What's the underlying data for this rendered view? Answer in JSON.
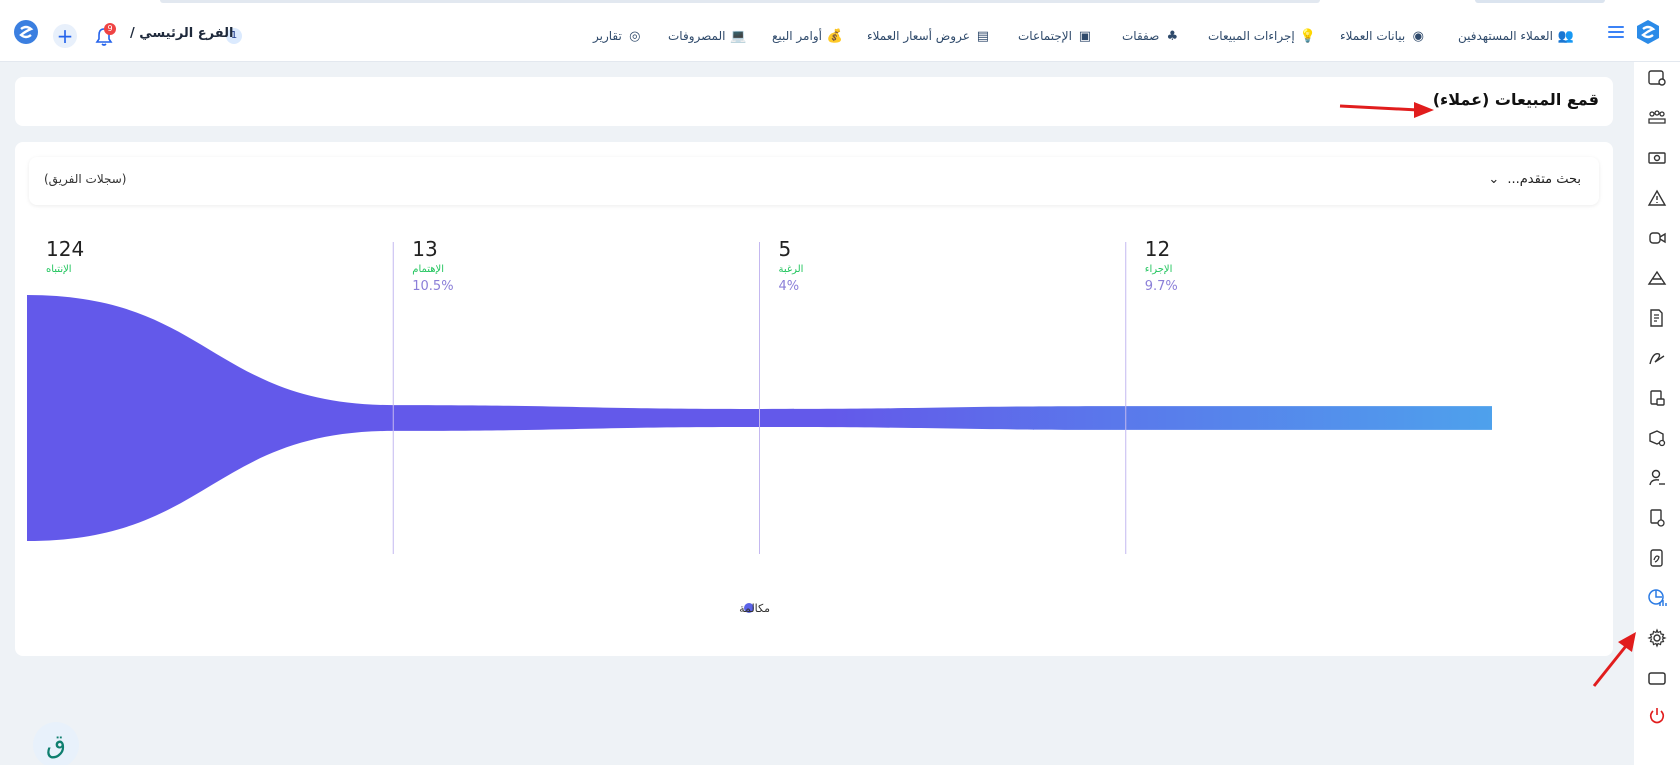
{
  "header": {
    "nav_items": [
      {
        "label": "العملاء المستهدفين",
        "icon": "target-customers-icon"
      },
      {
        "label": "بيانات العملاء",
        "icon": "customer-data-icon"
      },
      {
        "label": "إجراءات المبيعات",
        "icon": "bulb-icon"
      },
      {
        "label": "صفقات",
        "icon": "deals-icon"
      },
      {
        "label": "الإجتماعات",
        "icon": "meeting-board-icon"
      },
      {
        "label": "عروض أسعار العملاء",
        "icon": "quote-document-icon"
      },
      {
        "label": "أوامر البيع",
        "icon": "money-bag-icon"
      },
      {
        "label": "المصروفات",
        "icon": "laptop-icon"
      },
      {
        "label": "تقارير",
        "icon": "report-ring-icon"
      }
    ],
    "branch_label": "الفرع الرئيسي /",
    "branch_count": "1",
    "notifications_count": "9"
  },
  "page": {
    "title": "قمع المبيعات (عملاء)"
  },
  "filters": {
    "advanced_search": "بحث متقدم...",
    "team_records": "(سجلات الفريق)"
  },
  "chart_data": {
    "type": "funnel",
    "stages": [
      {
        "label": "الإنتباه",
        "value": 124,
        "percent": ""
      },
      {
        "label": "الإهتمام",
        "value": 13,
        "percent": "10.5%"
      },
      {
        "label": "الرغبة",
        "value": 5,
        "percent": "4%"
      },
      {
        "label": "الإجراء",
        "value": 12,
        "percent": "9.7%"
      }
    ],
    "legend": [
      {
        "name": "مكالمة",
        "color": "#5b63e8"
      }
    ],
    "colors": {
      "start": "#6359ea",
      "end": "#4ea1ec",
      "stage_label": "#22c55e",
      "percent": "#8b7fd8",
      "divider": "#c4b8f0"
    }
  },
  "sidebar": {
    "icons": [
      "folder-settings-icon",
      "team-icon",
      "money-icon",
      "warning-icon",
      "camera-icon",
      "mountain-icon",
      "invoice-icon",
      "signature-icon",
      "receipt-icon",
      "box-settings-icon",
      "user-settings-icon",
      "document-add-icon",
      "contract-icon",
      "funnel-report-icon",
      "gear-icon",
      "window-icon",
      "power-icon"
    ]
  },
  "colors": {
    "accent": "#2b7be4",
    "background": "#eef2f6",
    "annotation_arrow": "#e11d1d"
  }
}
